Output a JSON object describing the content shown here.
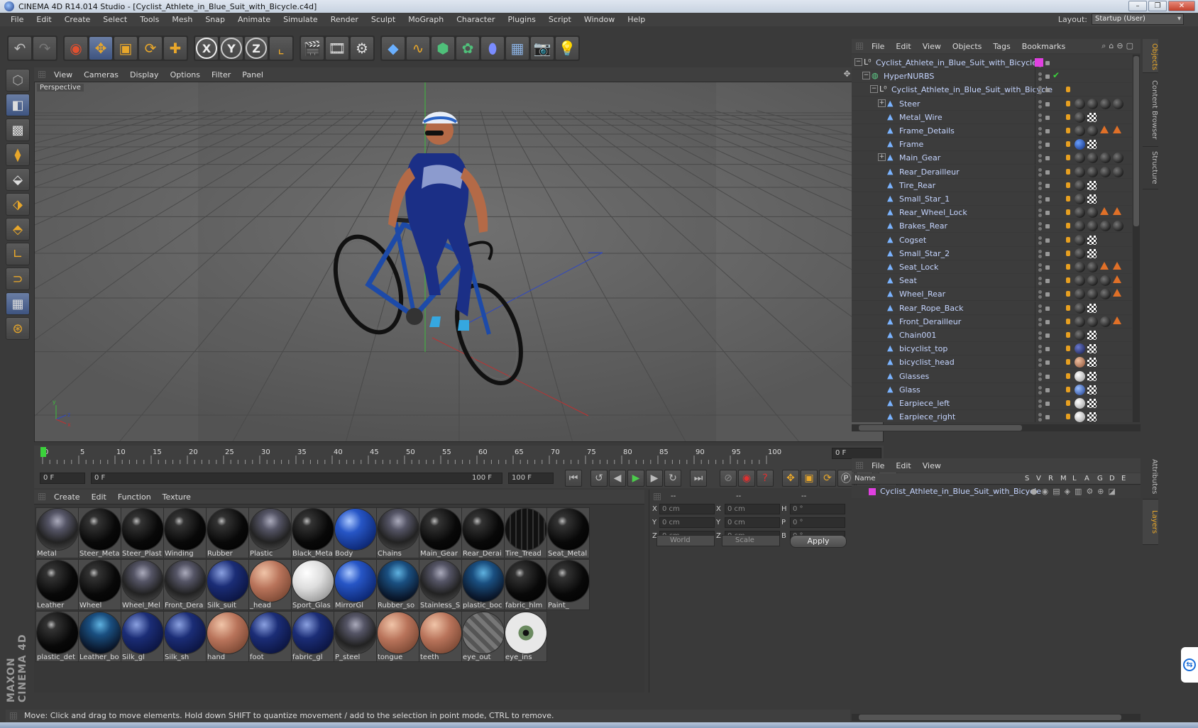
{
  "window": {
    "title": "CINEMA 4D R14.014 Studio - [Cyclist_Athlete_in_Blue_Suit_with_Bicycle.c4d]"
  },
  "menubar": {
    "items": [
      "File",
      "Edit",
      "Create",
      "Select",
      "Tools",
      "Mesh",
      "Snap",
      "Animate",
      "Simulate",
      "Render",
      "Sculpt",
      "MoGraph",
      "Character",
      "Plugins",
      "Script",
      "Window",
      "Help"
    ]
  },
  "layout": {
    "label": "Layout:",
    "value": "Startup (User)"
  },
  "viewport": {
    "menu": [
      "View",
      "Cameras",
      "Display",
      "Options",
      "Filter",
      "Panel"
    ],
    "label": "Perspective"
  },
  "timeline": {
    "ticks": [
      "0",
      "5",
      "10",
      "15",
      "20",
      "25",
      "30",
      "35",
      "40",
      "45",
      "50",
      "55",
      "60",
      "65",
      "70",
      "75",
      "80",
      "85",
      "90",
      "95",
      "100"
    ],
    "current_frame": "0 F",
    "start": "0 F",
    "range_start": "0 F",
    "range_end": "100 F",
    "end": "100 F"
  },
  "material_manager": {
    "menu": [
      "Create",
      "Edit",
      "Function",
      "Texture"
    ],
    "materials": [
      {
        "name": "Metal",
        "style": "env"
      },
      {
        "name": "Steer_Meta",
        "style": "black"
      },
      {
        "name": "Steer_Plast",
        "style": "black"
      },
      {
        "name": "Winding",
        "style": "black"
      },
      {
        "name": "Rubber",
        "style": "black"
      },
      {
        "name": "Plastic",
        "style": "env"
      },
      {
        "name": "Black_Meta",
        "style": "black"
      },
      {
        "name": "Body",
        "style": "blue"
      },
      {
        "name": "Chains",
        "style": "env"
      },
      {
        "name": "Main_Gear",
        "style": "black"
      },
      {
        "name": "Rear_Derai",
        "style": "black"
      },
      {
        "name": "Tire_Tread",
        "style": "tread"
      },
      {
        "name": "Seat_Metal",
        "style": "black"
      },
      {
        "name": "Leather",
        "style": "black"
      },
      {
        "name": "Wheel",
        "style": "black"
      },
      {
        "name": "Wheel_Mel",
        "style": "env"
      },
      {
        "name": "Front_Dera",
        "style": "env"
      },
      {
        "name": "Silk_suit",
        "style": "navy"
      },
      {
        "name": "_head",
        "style": "skin"
      },
      {
        "name": "Sport_Glas",
        "style": "white"
      },
      {
        "name": "MirrorGl",
        "style": "blue"
      },
      {
        "name": "Rubber_so",
        "style": "bluepatt"
      },
      {
        "name": "Stainless_S",
        "style": "env"
      },
      {
        "name": "plastic_boc",
        "style": "bluepatt"
      },
      {
        "name": "fabric_hlm",
        "style": "black"
      },
      {
        "name": "Paint_",
        "style": "black"
      },
      {
        "name": "plastic_det",
        "style": "black"
      },
      {
        "name": "Leather_bo",
        "style": "bluepatt"
      },
      {
        "name": "Silk_gl",
        "style": "navy"
      },
      {
        "name": "Silk_sh",
        "style": "navy"
      },
      {
        "name": "hand",
        "style": "skin"
      },
      {
        "name": "foot",
        "style": "navy"
      },
      {
        "name": "fabric_gl",
        "style": "navy"
      },
      {
        "name": "P_steel",
        "style": "env"
      },
      {
        "name": "tongue",
        "style": "skin"
      },
      {
        "name": "teeth",
        "style": "skin"
      },
      {
        "name": "eye_out",
        "style": "stripe"
      },
      {
        "name": "eye_ins",
        "style": "eye"
      }
    ]
  },
  "coordinates": {
    "headers": [
      "--",
      "--",
      "--"
    ],
    "rows": [
      {
        "a": "X",
        "av": "0 cm",
        "b": "X",
        "bv": "0 cm",
        "c": "H",
        "cv": "0 °"
      },
      {
        "a": "Y",
        "av": "0 cm",
        "b": "Y",
        "bv": "0 cm",
        "c": "P",
        "cv": "0 °"
      },
      {
        "a": "Z",
        "av": "0 cm",
        "b": "Z",
        "bv": "0 cm",
        "c": "B",
        "cv": "0 °"
      }
    ],
    "mode": "World",
    "scale": "Scale",
    "apply": "Apply"
  },
  "object_manager": {
    "menu": [
      "File",
      "Edit",
      "View",
      "Objects",
      "Tags",
      "Bookmarks"
    ],
    "objects": [
      {
        "name": "Cyclist_Athlete_in_Blue_Suit_with_Bicycle",
        "depth": 0,
        "tree": "−",
        "icon": "null"
      },
      {
        "name": "HyperNURBS",
        "depth": 1,
        "tree": "−",
        "icon": "nurbs"
      },
      {
        "name": "Cyclist_Athlete_in_Blue_Suit_with_Bicycle",
        "depth": 2,
        "tree": "−",
        "icon": "null"
      },
      {
        "name": "Steer",
        "depth": 3,
        "tree": "+",
        "icon": "poly"
      },
      {
        "name": "Metal_Wire",
        "depth": 3,
        "tree": "",
        "icon": "poly"
      },
      {
        "name": "Frame_Details",
        "depth": 3,
        "tree": "",
        "icon": "poly"
      },
      {
        "name": "Frame",
        "depth": 3,
        "tree": "",
        "icon": "poly"
      },
      {
        "name": "Main_Gear",
        "depth": 3,
        "tree": "+",
        "icon": "poly"
      },
      {
        "name": "Rear_Derailleur",
        "depth": 3,
        "tree": "",
        "icon": "poly"
      },
      {
        "name": "Tire_Rear",
        "depth": 3,
        "tree": "",
        "icon": "poly"
      },
      {
        "name": "Small_Star_1",
        "depth": 3,
        "tree": "",
        "icon": "poly"
      },
      {
        "name": "Rear_Wheel_Lock",
        "depth": 3,
        "tree": "",
        "icon": "poly"
      },
      {
        "name": "Brakes_Rear",
        "depth": 3,
        "tree": "",
        "icon": "poly"
      },
      {
        "name": "Cogset",
        "depth": 3,
        "tree": "",
        "icon": "poly"
      },
      {
        "name": "Small_Star_2",
        "depth": 3,
        "tree": "",
        "icon": "poly"
      },
      {
        "name": "Seat_Lock",
        "depth": 3,
        "tree": "",
        "icon": "poly"
      },
      {
        "name": "Seat",
        "depth": 3,
        "tree": "",
        "icon": "poly"
      },
      {
        "name": "Wheel_Rear",
        "depth": 3,
        "tree": "",
        "icon": "poly"
      },
      {
        "name": "Rear_Rope_Back",
        "depth": 3,
        "tree": "",
        "icon": "poly"
      },
      {
        "name": "Front_Derailleur",
        "depth": 3,
        "tree": "",
        "icon": "poly"
      },
      {
        "name": "Chain001",
        "depth": 3,
        "tree": "",
        "icon": "poly"
      },
      {
        "name": "bicyclist_top",
        "depth": 3,
        "tree": "",
        "icon": "poly"
      },
      {
        "name": "bicyclist_head",
        "depth": 3,
        "tree": "",
        "icon": "poly"
      },
      {
        "name": "Glasses",
        "depth": 3,
        "tree": "",
        "icon": "poly"
      },
      {
        "name": "Glass",
        "depth": 3,
        "tree": "",
        "icon": "poly"
      },
      {
        "name": "Earpiece_left",
        "depth": 3,
        "tree": "",
        "icon": "poly"
      },
      {
        "name": "Earpiece_right",
        "depth": 3,
        "tree": "",
        "icon": "poly"
      }
    ]
  },
  "side_tabs": [
    "Objects",
    "Content Browser",
    "Structure"
  ],
  "side_tabs2": [
    "Attributes",
    "Layers"
  ],
  "layer_manager": {
    "menu": [
      "File",
      "Edit",
      "View"
    ],
    "columns": [
      "Name",
      "S",
      "V",
      "R",
      "M",
      "L",
      "A",
      "G",
      "D",
      "E"
    ],
    "layer_name": "Cyclist_Athlete_in_Blue_Suit_with_Bicycle",
    "layer_color": "#e040e0"
  },
  "status": "Move: Click and drag to move elements. Hold down SHIFT to quantize movement / add to the selection in point mode, CTRL to remove.",
  "brand": "MAXON CINEMA 4D",
  "colors": {
    "accent": "#e8a72b",
    "object_text": "#c5d5ff",
    "x_axis": "#d03030",
    "y_axis": "#30c030",
    "z_axis": "#3050d0"
  }
}
